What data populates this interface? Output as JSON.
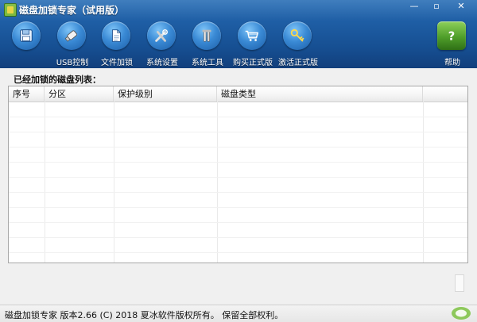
{
  "window": {
    "title": "磁盘加锁专家（试用版）",
    "minimize": "—",
    "restore": "▫",
    "close": "✕"
  },
  "toolbar": {
    "items": [
      {
        "label": "",
        "icon": "floppy-disk-icon"
      },
      {
        "label": "USB控制",
        "icon": "usb-drive-icon"
      },
      {
        "label": "文件加锁",
        "icon": "document-icon"
      },
      {
        "label": "系统设置",
        "icon": "tools-icon"
      },
      {
        "label": "系统工具",
        "icon": "wrench-icon"
      },
      {
        "label": "购买正式版",
        "icon": "shopping-cart-icon"
      },
      {
        "label": "激活正式版",
        "icon": "key-icon"
      }
    ],
    "help": {
      "label": "帮助",
      "icon": "help-icon"
    }
  },
  "main": {
    "list_title": "已经加锁的磁盘列表：",
    "columns": [
      "序号",
      "分区",
      "保护级别",
      "磁盘类型"
    ],
    "rows": []
  },
  "status": {
    "text": "磁盘加锁专家  版本2.66 (C)  2018 夏冰软件版权所有。 保留全部权利。"
  },
  "colors": {
    "header_top": "#2a6fb6",
    "header_bottom": "#123f7c",
    "icon_blue": "#3a8ad5",
    "help_green": "#4f9e2a"
  }
}
